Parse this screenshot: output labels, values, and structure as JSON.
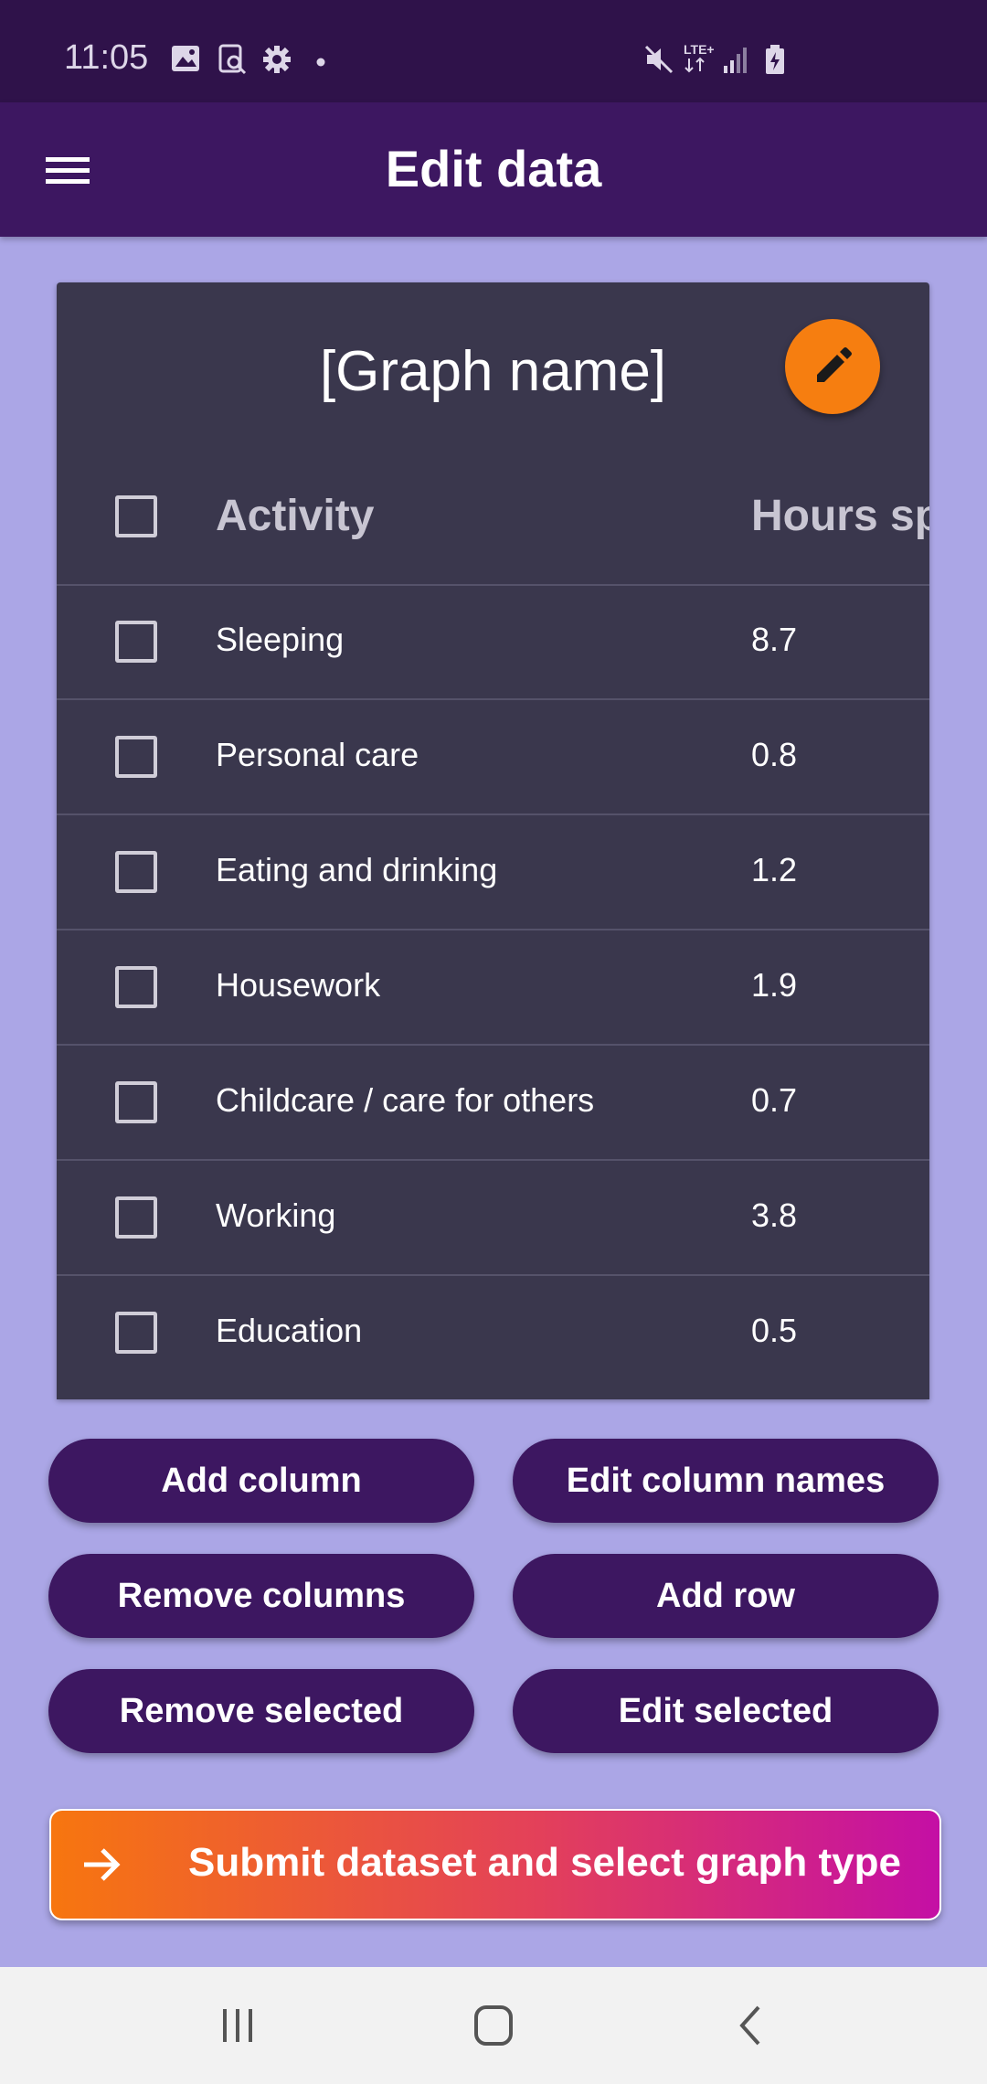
{
  "status_bar": {
    "time": "11:05",
    "left_icons": [
      "image-icon",
      "screenshot-search-icon",
      "settings-icon",
      "dot-icon"
    ],
    "right_icons": [
      "mute-icon",
      "lte-icon",
      "signal-icon",
      "battery-icon"
    ],
    "network_label": "LTE+"
  },
  "app_bar": {
    "title": "Edit data",
    "menu_icon": "hamburger-menu-icon"
  },
  "table_card": {
    "graph_name": "[Graph name]",
    "edit_icon": "pencil-icon",
    "columns": [
      "Activity",
      "Hours sp"
    ],
    "rows": [
      {
        "activity": "Sleeping",
        "hours": "8.7"
      },
      {
        "activity": "Personal care",
        "hours": "0.8"
      },
      {
        "activity": "Eating and drinking",
        "hours": "1.2"
      },
      {
        "activity": "Housework",
        "hours": "1.9"
      },
      {
        "activity": "Childcare / care for others",
        "hours": "0.7"
      },
      {
        "activity": "Working",
        "hours": "3.8"
      },
      {
        "activity": "Education",
        "hours": "0.5"
      }
    ]
  },
  "actions": {
    "add_column": "Add column",
    "edit_column_names": "Edit column names",
    "remove_columns": "Remove columns",
    "add_row": "Add row",
    "remove_selected": "Remove selected",
    "edit_selected": "Edit selected"
  },
  "submit": {
    "label": "Submit dataset and select graph type",
    "icon": "arrow-right-icon"
  },
  "nav_bar": {
    "icons": [
      "recent-apps-icon",
      "home-icon",
      "back-icon"
    ]
  },
  "colors": {
    "background": "#aba6e6",
    "app_bar": "#3d1761",
    "status_bar": "#2f124a",
    "card": "#3a374d",
    "fab": "#f67e10",
    "gradient_start": "#f7760f",
    "gradient_end": "#c40fa5"
  }
}
